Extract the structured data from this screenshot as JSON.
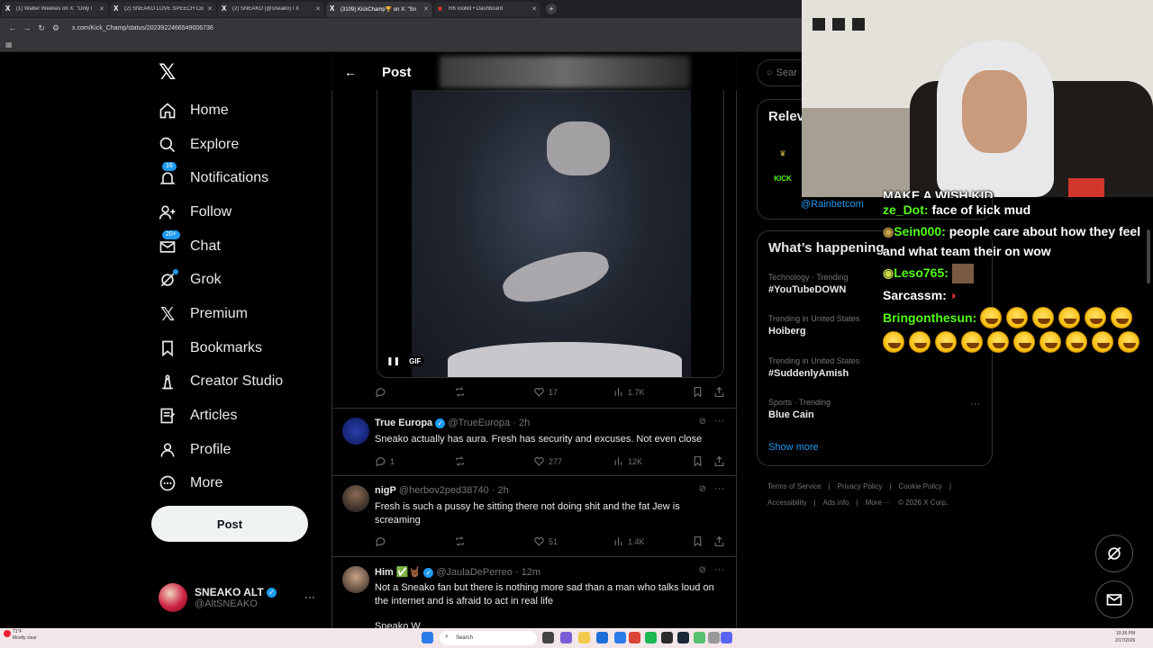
{
  "browser": {
    "tabs": [
      {
        "label": "(1) Walter Weekes on X: \"Only I",
        "active": false
      },
      {
        "label": "(2) SNEAKO LOVE SPEECH Com",
        "active": false
      },
      {
        "label": "(2) SNEAKO (@sneako) / X",
        "active": false
      },
      {
        "label": "(3109) KickChamp🏆 on X: \"Sn",
        "active": true
      },
      {
        "label": "RKToolkit • Dashboard",
        "active": false
      }
    ],
    "url": "x.com/Kick_Champ/status/2023922466549006736"
  },
  "nav": {
    "items": [
      {
        "label": "Home"
      },
      {
        "label": "Explore"
      },
      {
        "label": "Notifications",
        "badge": "16"
      },
      {
        "label": "Follow"
      },
      {
        "label": "Chat",
        "badge": "20+"
      },
      {
        "label": "Grok"
      },
      {
        "label": "Premium"
      },
      {
        "label": "Bookmarks"
      },
      {
        "label": "Creator Studio"
      },
      {
        "label": "Articles"
      },
      {
        "label": "Profile"
      },
      {
        "label": "More"
      }
    ],
    "post_button": "Post",
    "account": {
      "name": "SNEAKO ALT",
      "handle": "@AltSNEAKO"
    }
  },
  "center": {
    "title": "Post",
    "media": {
      "gif_label": "GIF"
    },
    "main_actions": {
      "replies": "",
      "likes": "17",
      "views": "1.7K"
    },
    "replies": [
      {
        "name": "True Europa",
        "handle": "@TrueEuropa",
        "time": "· 2h",
        "text": "Sneako actually has aura. Fresh has security and excuses. Not even close",
        "replies": "1",
        "likes": "277",
        "views": "12K"
      },
      {
        "name": "nigP",
        "handle": "@herbov2ped38740",
        "time": "· 2h",
        "text": "Fresh is such a pussy he sitting there not doing shit and the fat Jew is screaming",
        "replies": "",
        "likes": "51",
        "views": "1.4K"
      },
      {
        "name": "Him ✅🤘🏾",
        "handle": "@JaulaDePerreo",
        "time": "· 12m",
        "text": "Not a Sneako fan but there is nothing more sad than a man who talks loud on the internet and is afraid to act in real life",
        "text2": "Sneako W"
      }
    ]
  },
  "right": {
    "search_placeholder": "Sear",
    "relevant": {
      "title": "Relev",
      "link": "@Rainbetcom",
      "logo": "KICK"
    },
    "happening": {
      "title": "What’s happening",
      "trends": [
        {
          "context": "Technology · Trending",
          "name": "#YouTubeDOWN"
        },
        {
          "context": "Trending in United States",
          "name": "Hoiberg"
        },
        {
          "context": "Trending in United States",
          "name": "#SuddenlyAmish"
        },
        {
          "context": "Sports · Trending",
          "name": "Blue Cain"
        }
      ],
      "show_more": "Show more"
    },
    "footer": [
      "Terms of Service",
      "|",
      "Privacy Policy",
      "|",
      "Cookie Policy",
      "|",
      "Accessibility",
      "|",
      "Ads info",
      "|",
      "More ···",
      "© 2026 X Corp."
    ]
  },
  "chat": {
    "lines": [
      {
        "user": "",
        "text": "MAKE A WISH KID"
      },
      {
        "user": "ze_Dot:",
        "text": "face of kick mud"
      },
      {
        "user": "Sein000:",
        "text": "people care about how they feel and what team their on wow"
      },
      {
        "user": "Leso765:",
        "text": ""
      },
      {
        "user": "Sarcassm:",
        "text": ""
      },
      {
        "user": "Bringonthesun:",
        "text": ""
      }
    ]
  },
  "taskbar": {
    "weather_temp": "71°F",
    "weather_desc": "Mostly clear",
    "search": "Search",
    "time": "10:36 PM",
    "date": "2/17/2026"
  }
}
